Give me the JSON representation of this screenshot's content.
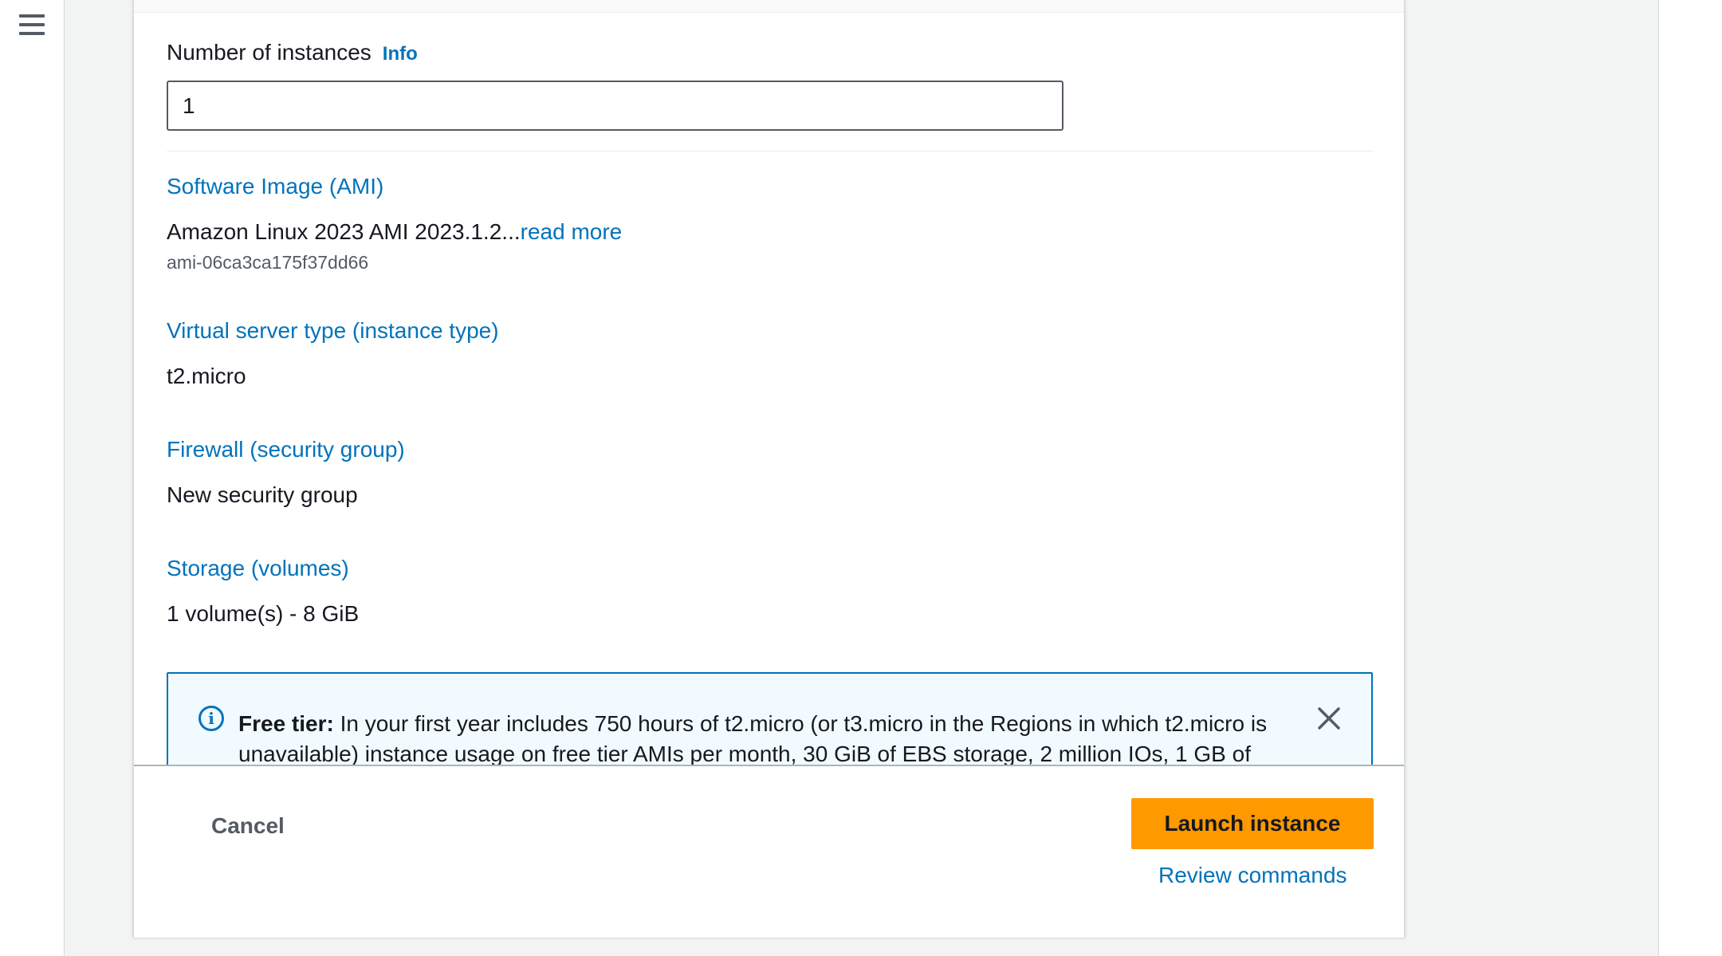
{
  "nav": {
    "menu_icon": "hamburger-menu-icon"
  },
  "instances": {
    "label": "Number of instances",
    "info": "Info",
    "value": "1"
  },
  "summary": {
    "ami": {
      "title": "Software Image (AMI)",
      "value": "Amazon Linux 2023 AMI 2023.1.2...",
      "read_more": "read more",
      "id": "ami-06ca3ca175f37dd66"
    },
    "instance_type": {
      "title": "Virtual server type (instance type)",
      "value": "t2.micro"
    },
    "firewall": {
      "title": "Firewall (security group)",
      "value": "New security group"
    },
    "storage": {
      "title": "Storage (volumes)",
      "value": "1 volume(s) - 8 GiB"
    }
  },
  "free_tier": {
    "icon": "info-circle-icon",
    "label": "Free tier:",
    "text": " In your first year includes 750 hours of t2.micro (or t3.micro in the Regions in which t2.micro is unavailable) instance usage on free tier AMIs per month, 30 GiB of EBS storage, 2 million IOs, 1 GB of",
    "close_icon": "close-icon"
  },
  "footer": {
    "cancel": "Cancel",
    "launch": "Launch instance",
    "review": "Review commands"
  },
  "colors": {
    "link": "#0073bb",
    "primary_button": "#ff9900",
    "alert_background": "#f1faff",
    "text": "#16191f"
  }
}
